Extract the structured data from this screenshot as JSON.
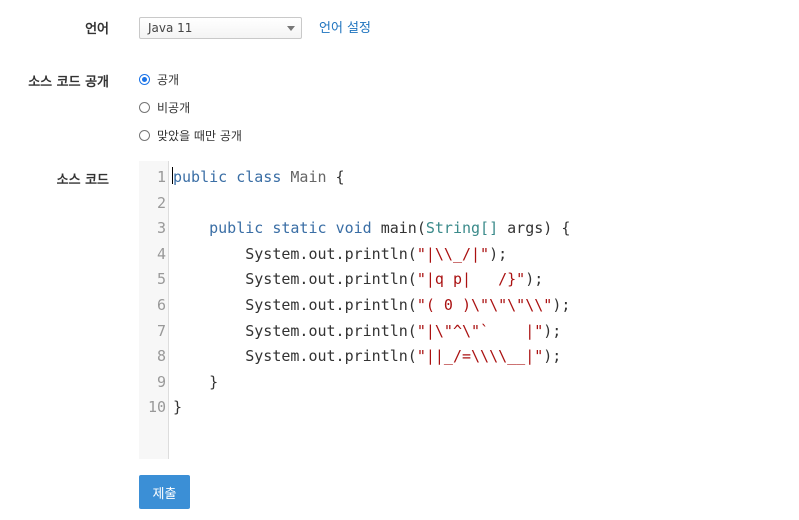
{
  "language": {
    "label": "언어",
    "selected": "Java 11",
    "settings_link": "언어 설정"
  },
  "visibility": {
    "label": "소스 코드 공개",
    "options": [
      {
        "text": "공개",
        "checked": true
      },
      {
        "text": "비공개",
        "checked": false
      },
      {
        "text": "맞았을 때만 공개",
        "checked": false
      }
    ]
  },
  "source": {
    "label": "소스 코드",
    "line_numbers": [
      "1",
      "2",
      "3",
      "4",
      "5",
      "6",
      "7",
      "8",
      "9",
      "10"
    ],
    "lines": [
      [
        {
          "t": "public",
          "c": "kw"
        },
        {
          "t": " "
        },
        {
          "t": "class",
          "c": "kw"
        },
        {
          "t": " "
        },
        {
          "t": "Main",
          "c": "cls"
        },
        {
          "t": " {"
        }
      ],
      [],
      [
        {
          "t": "    "
        },
        {
          "t": "public",
          "c": "kw"
        },
        {
          "t": " "
        },
        {
          "t": "static",
          "c": "kw"
        },
        {
          "t": " "
        },
        {
          "t": "void",
          "c": "kw"
        },
        {
          "t": " main("
        },
        {
          "t": "String[]",
          "c": "typ"
        },
        {
          "t": " args) {"
        }
      ],
      [
        {
          "t": "        System.out.println("
        },
        {
          "t": "\"|\\\\_/|\"",
          "c": "str"
        },
        {
          "t": ");"
        }
      ],
      [
        {
          "t": "        System.out.println("
        },
        {
          "t": "\"|q p|   /}\"",
          "c": "str"
        },
        {
          "t": ");"
        }
      ],
      [
        {
          "t": "        System.out.println("
        },
        {
          "t": "\"( 0 )\\\"\\\"\\\"\\\\\"",
          "c": "str"
        },
        {
          "t": ");"
        }
      ],
      [
        {
          "t": "        System.out.println("
        },
        {
          "t": "\"|\\\"^\\\"`    |\"",
          "c": "str"
        },
        {
          "t": ");"
        }
      ],
      [
        {
          "t": "        System.out.println("
        },
        {
          "t": "\"||_/=\\\\\\\\__|\"",
          "c": "str"
        },
        {
          "t": ");"
        }
      ],
      [
        {
          "t": "    }"
        }
      ],
      [
        {
          "t": "}"
        }
      ]
    ]
  },
  "submit": {
    "label": "제출"
  }
}
